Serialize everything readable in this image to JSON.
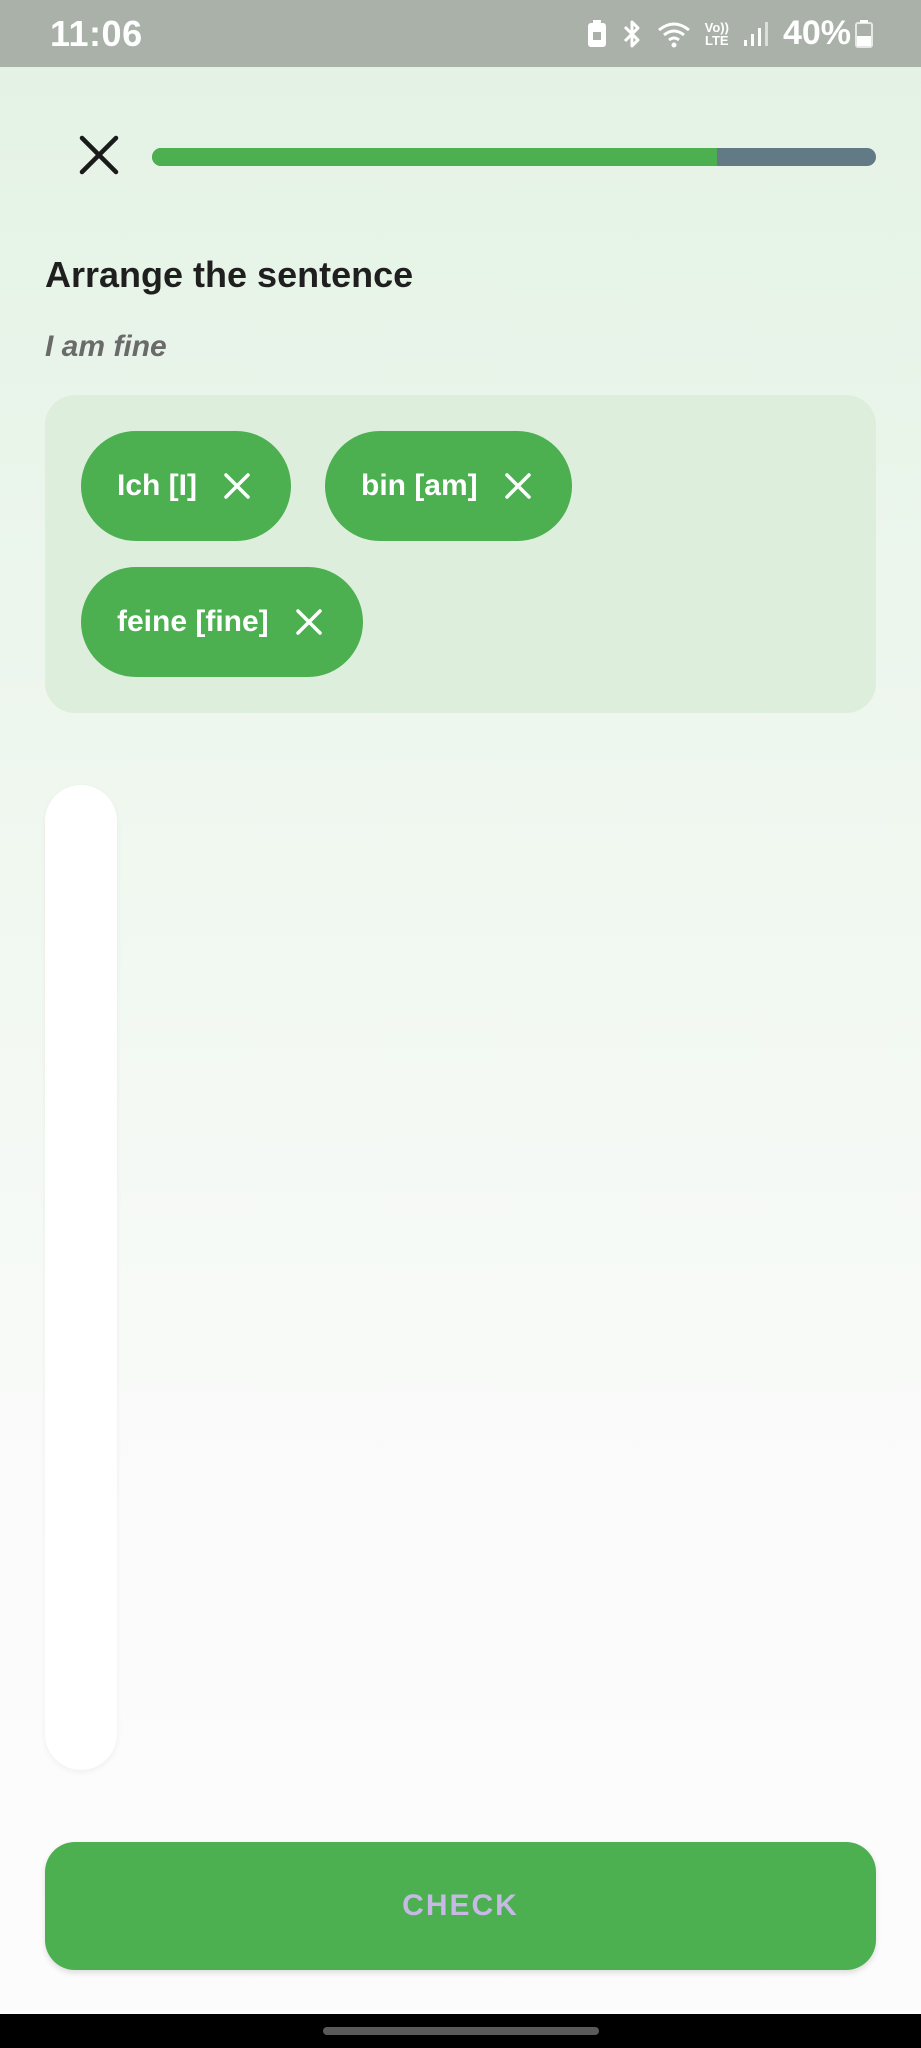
{
  "status_bar": {
    "time": "11:06",
    "battery_percent": "40%",
    "icons": [
      "battery-saver-icon",
      "bluetooth-icon",
      "wifi-icon",
      "volte-icon",
      "signal-icon",
      "battery-icon"
    ],
    "volte_line1": "Vo))",
    "volte_line2": "LTE"
  },
  "header": {
    "close_icon": "close-icon",
    "progress_fraction": 0.78,
    "progress_color": "#4caf50",
    "track_color": "#627a86"
  },
  "exercise": {
    "title": "Arrange the sentence",
    "prompt": "I am fine"
  },
  "answer_chips": [
    {
      "label": "Ich [I]",
      "remove_icon": "close-icon"
    },
    {
      "label": "bin [am]",
      "remove_icon": "close-icon"
    },
    {
      "label": "feine [fine]",
      "remove_icon": "close-icon"
    }
  ],
  "footer": {
    "check_label": "CHECK",
    "button_color": "#4caf50",
    "label_color": "#c8b8e6"
  }
}
